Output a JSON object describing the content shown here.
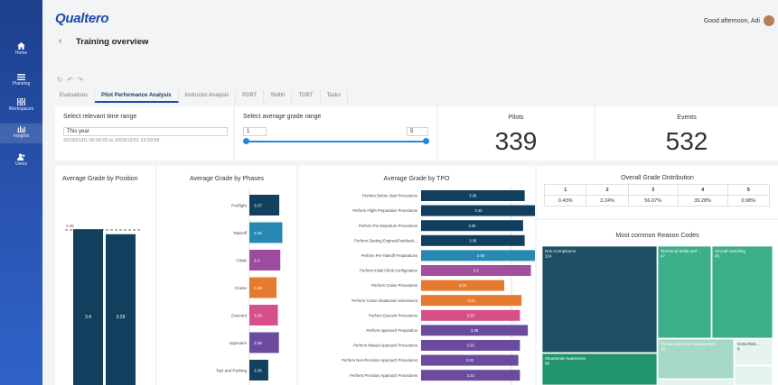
{
  "app": {
    "logo": "Qualtero",
    "greeting": "Good afternoon, Adi"
  },
  "sidebar": {
    "items": [
      {
        "label": "Home",
        "icon": "home-icon"
      },
      {
        "label": "Planning",
        "icon": "list-icon"
      },
      {
        "label": "Workspaces",
        "icon": "grid-icon"
      },
      {
        "label": "Insights",
        "icon": "bar-chart-icon"
      },
      {
        "label": "Users",
        "icon": "users-icon"
      }
    ]
  },
  "header": {
    "back": "‹",
    "title": "Training overview",
    "chevron": "⌄",
    "toolbar_icons": [
      "↻",
      "↶",
      "↷"
    ]
  },
  "tabs": [
    "Evaluations",
    "Pilot Performance Analysis",
    "Instructor Analysis",
    "PDRT",
    "Skilltri",
    "TORT",
    "Tasks"
  ],
  "active_tab": "Pilot Performance Analysis",
  "filters": {
    "time_title": "Select relevant time range",
    "time_value": "This year",
    "time_sub": "2023/01/01 00:00:00 to 2023/12/31 23:59:59",
    "grade_title": "Select average grade range",
    "grade_min": "1",
    "grade_max": "5",
    "slider_range": [
      1,
      5
    ]
  },
  "kpis": {
    "pilots_label": "Pilots",
    "pilots_value": "339",
    "events_label": "Events",
    "events_value": "532"
  },
  "position": {
    "title": "Average Grade by Position",
    "ref_label": "3.36",
    "values": [
      3.4,
      3.29
    ]
  },
  "phases": {
    "title": "Average Grade by Phases",
    "items": [
      {
        "label": "Preflight",
        "value": 3.37,
        "color": "#12405e"
      },
      {
        "label": "Takeoff",
        "value": 3.46,
        "color": "#2788b2"
      },
      {
        "label": "Climb",
        "value": 3.4,
        "color": "#9c4b9f"
      },
      {
        "label": "Cruise",
        "value": 3.29,
        "color": "#e67a2e"
      },
      {
        "label": "Descent",
        "value": 3.33,
        "color": "#d64f8a"
      },
      {
        "label": "Approach",
        "value": 3.36,
        "color": "#6a4b9e"
      },
      {
        "label": "Taxi and Parking",
        "value": 3.05,
        "color": "#12405e"
      }
    ]
  },
  "tpo": {
    "title": "Average Grade by TPO",
    "items": [
      {
        "label": "Perform Before Start Procedures",
        "value": 3.36,
        "color": "#123f5d"
      },
      {
        "label": "Perform Flight Preparation Procedures",
        "value": 3.43,
        "color": "#123f5d"
      },
      {
        "label": "Perform Pre-Departure Procedures",
        "value": 3.35,
        "color": "#123f5d"
      },
      {
        "label": "Perform Starting Engines/Pushback...",
        "value": 3.36,
        "color": "#123f5d"
      },
      {
        "label": "Perform Pre-Takeoff Preparations",
        "value": 3.46,
        "color": "#2788b2"
      },
      {
        "label": "Perform Initial Climb Configuration",
        "value": 3.4,
        "color": "#a1509f"
      },
      {
        "label": "Perform Cruise Procedures",
        "value": 3.23,
        "color": "#e67a2e"
      },
      {
        "label": "Perform Cruise Situational Assessment",
        "value": 3.34,
        "color": "#e67a2e"
      },
      {
        "label": "Perform Descent Procedures",
        "value": 3.33,
        "color": "#d64f8a"
      },
      {
        "label": "Perform Approach Preparation",
        "value": 3.38,
        "color": "#6a4b9e"
      },
      {
        "label": "Perform Missed Approach Procedures",
        "value": 3.33,
        "color": "#6a4b9e"
      },
      {
        "label": "Perform Non-Precision Approach Procedures",
        "value": 3.32,
        "color": "#6a4b9e"
      },
      {
        "label": "Perform Precision Approach Procedures",
        "value": 3.33,
        "color": "#6a4b9e"
      }
    ]
  },
  "distribution": {
    "title": "Overall Grade Distribution",
    "grades": [
      "1",
      "2",
      "3",
      "4",
      "5"
    ],
    "percents": [
      "0.43%",
      "3.24%",
      "56.07%",
      "39.28%",
      "0.98%"
    ]
  },
  "reasons": {
    "title": "Most common Reason Codes",
    "items": [
      {
        "label": "Non-Compliance",
        "count": "114",
        "color": "#1f4f66"
      },
      {
        "label": "Technical Skills and ...",
        "count": "47",
        "color": "#3cae8a"
      },
      {
        "label": "Aircraft Handling",
        "count": "45",
        "color": "#3cae8a"
      },
      {
        "label": "Situational Awareness",
        "count": "66",
        "color": "#21946e"
      },
      {
        "label": "Threat and Error Management",
        "count": "25",
        "color": "#a6d8c6"
      },
      {
        "label": "Crew Res...",
        "count": "8",
        "color": "#e6f3ee"
      }
    ]
  },
  "colors": {
    "accent": "#1f4aa8",
    "sidebar": "#2a56b5"
  }
}
